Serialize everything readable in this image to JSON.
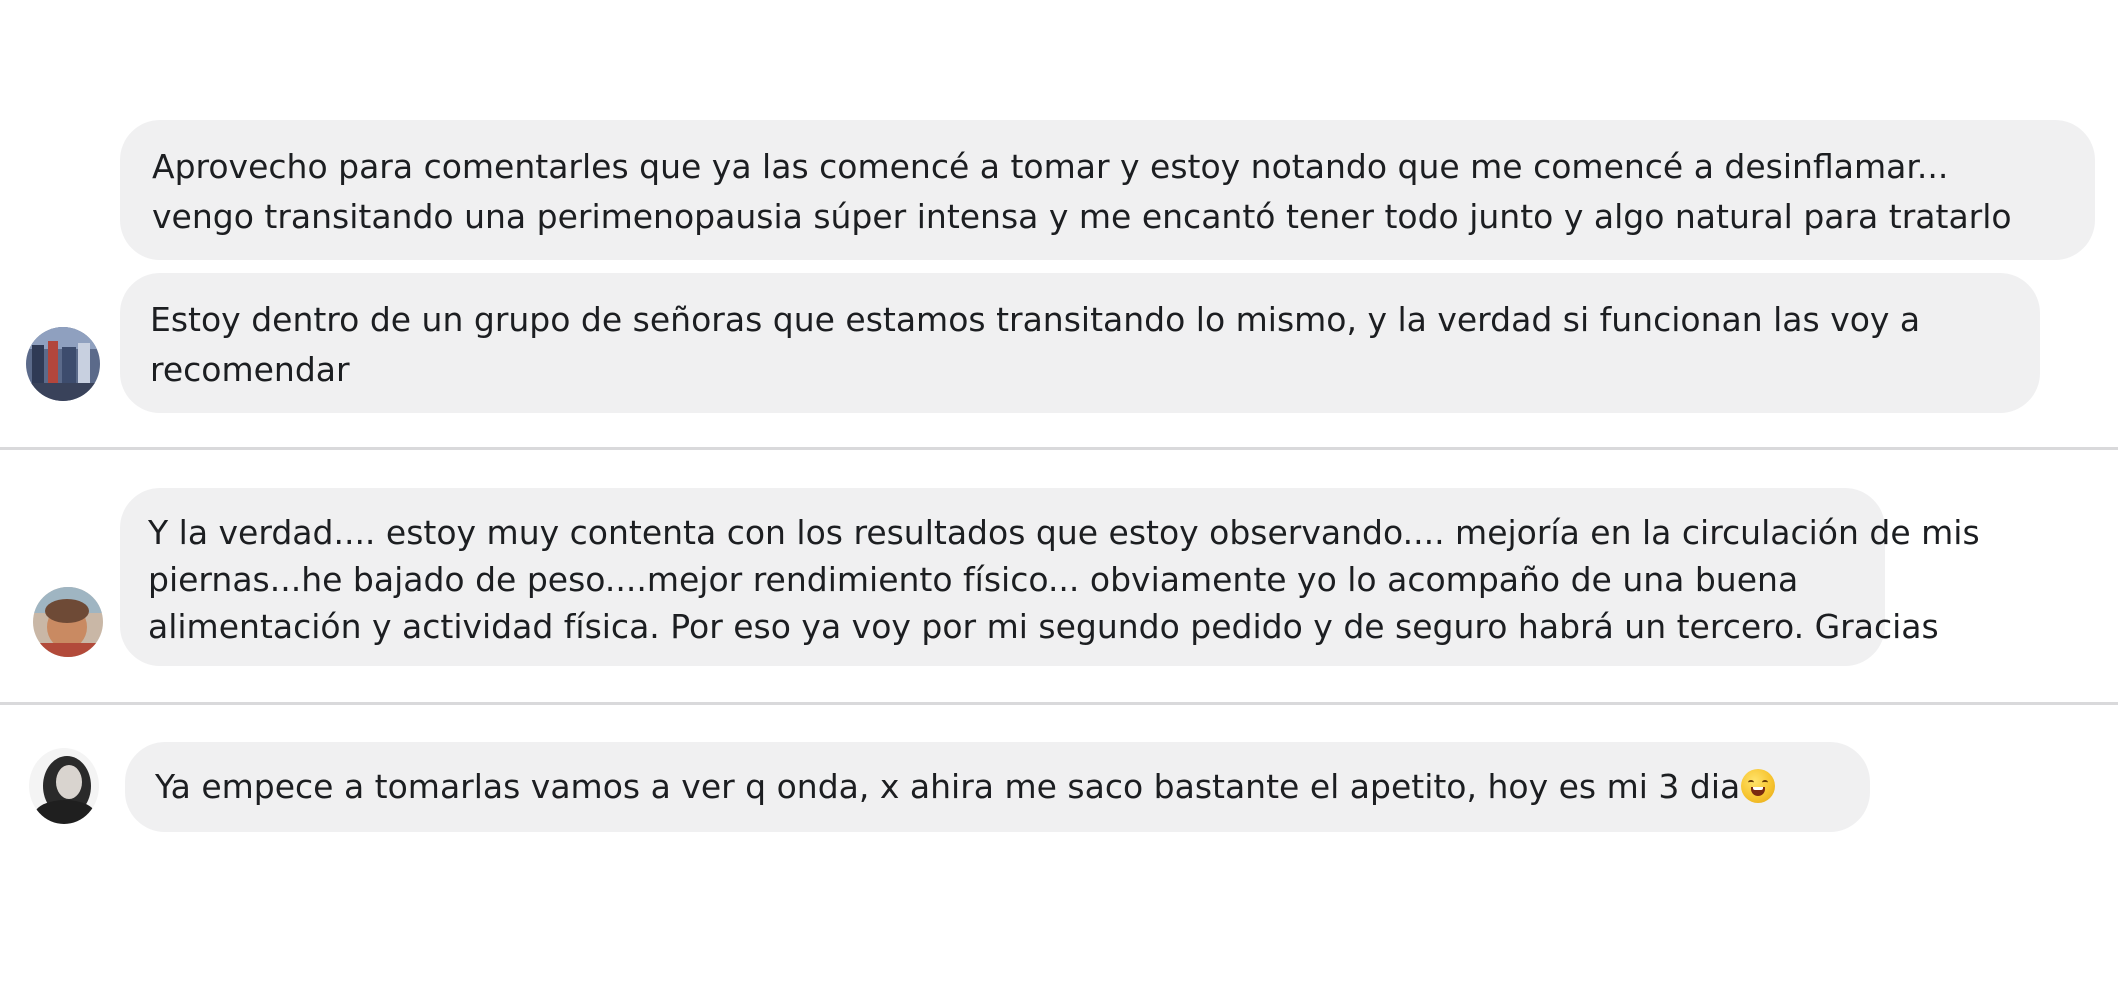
{
  "comments": [
    {
      "lines": [
        "Aprovecho para comentarles que ya las comencé a tomar y estoy notando que me comencé a desinflamar...",
        "vengo transitando una perimenopausia súper intensa y me encantó tener todo junto y algo natural para tratarlo"
      ]
    },
    {
      "lines": [
        "Estoy dentro de un grupo de señoras que estamos transitando lo mismo, y la verdad si funcionan las voy a",
        "recomendar"
      ]
    },
    {
      "lines": [
        "Y la verdad.... estoy muy contenta con los resultados que estoy observando.... mejoría en la circulación de mis",
        "piernas...he bajado de peso....mejor rendimiento físico... obviamente yo lo acompaño de una buena",
        "alimentación y actividad física. Por eso ya voy por mi segundo pedido y de seguro habrá un tercero. Gracias"
      ]
    },
    {
      "lines": [
        "Ya empece a tomarlas vamos a ver q onda, x ahira me saco bastante el apetito, hoy es mi 3 dia"
      ],
      "emoji": "grinning-face-emoji"
    }
  ],
  "colors": {
    "bubble": "#f0f0f1",
    "text": "#1c1e21",
    "divider": "#d9d9db",
    "background": "#ffffff"
  }
}
